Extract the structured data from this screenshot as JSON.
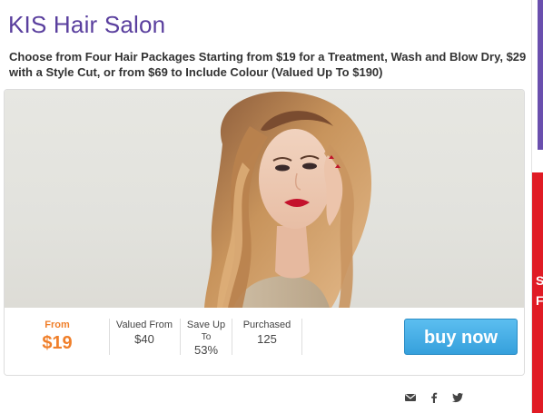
{
  "header": {
    "title": "KIS Hair Salon",
    "description": "Choose from Four Hair Packages Starting from $19 for a Treatment, Wash and Blow Dry, $29 with a Style Cut, or from $69 to Include Colour (Valued Up To $190)"
  },
  "deal": {
    "from_label": "From",
    "from_price": "$19",
    "valued_label": "Valued From",
    "valued_value": "$40",
    "save_label_line1": "Save Up",
    "save_label_line2": "To",
    "save_value": "53%",
    "purchased_label": "Purchased",
    "purchased_value": "125",
    "buy_label": "buy now"
  },
  "share": {
    "icons": [
      "email-icon",
      "facebook-icon",
      "twitter-icon"
    ]
  },
  "sidebar_ad": {
    "text": "S\nF"
  },
  "colors": {
    "title": "#5a3f9e",
    "price": "#f07f2a",
    "button": "#36a0dc",
    "ad_red": "#e01b24",
    "ad_purple": "#6a4fae"
  }
}
